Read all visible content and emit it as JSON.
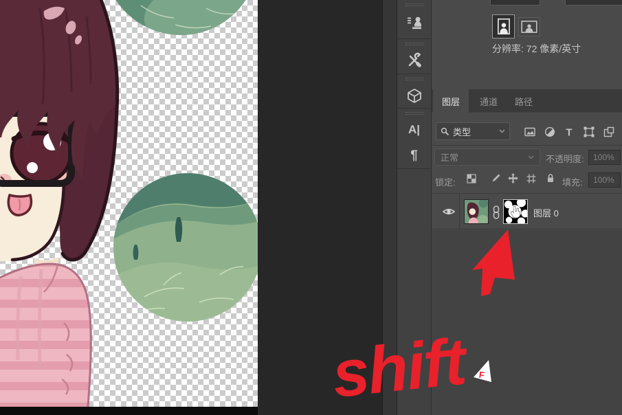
{
  "properties": {
    "resolution_text": "分辨率: 72 像素/英寸",
    "orientation_selected": "portrait"
  },
  "panel": {
    "tabs": [
      {
        "label": "图层"
      },
      {
        "label": "通道"
      },
      {
        "label": "路径"
      }
    ],
    "filter_label": "类型",
    "blend_mode": "正常",
    "opacity_label": "不透明度:",
    "opacity_value": "100%",
    "lock_label": "锁定:",
    "fill_label": "填充:",
    "fill_value": "100%",
    "layer_name": "图层 0",
    "type_filter_glyph": "T"
  },
  "dock": {
    "character_glyph": "A|",
    "paragraph_glyph": "¶"
  },
  "annotation": {
    "text": "shift",
    "watermark": "F"
  },
  "colors": {
    "annotation_red": "#e8212b",
    "pasteboard": "#272727",
    "panel_bg": "#4a4a4a",
    "checker_gray": "#cbcbcb"
  }
}
